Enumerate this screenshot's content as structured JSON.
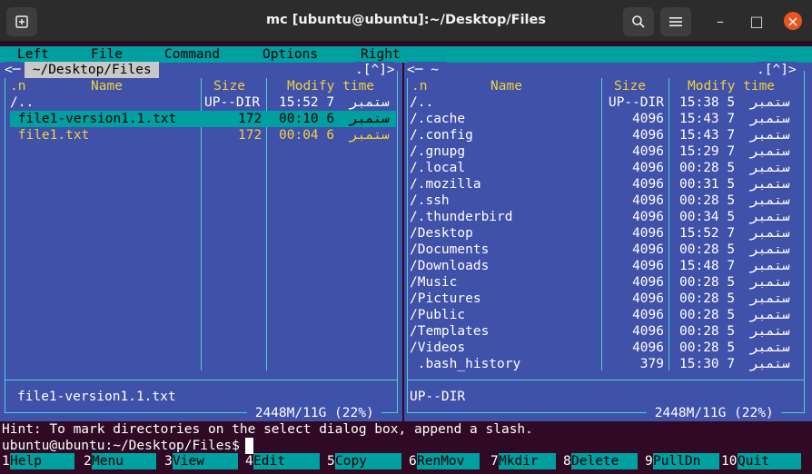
{
  "window": {
    "title": "mc [ubuntu@ubuntu]:~/Desktop/Files",
    "new_tab_icon": "new-tab-icon",
    "search_icon": "search-icon",
    "menu_icon": "hamburger-icon",
    "minimize": "–",
    "maximize": "□",
    "close": "×"
  },
  "menu": [
    "Left",
    "File",
    "Command",
    "Options",
    "Right"
  ],
  "left_panel": {
    "corner_left": "<─",
    "path": " ~/Desktop/Files ",
    "corner_right": ".[^]>",
    "headers": {
      "n": ".n",
      "name": "Name",
      "size": "Size",
      "modify": "Modify time"
    },
    "rows": [
      {
        "name": "/..",
        "size": "UP--DIR",
        "time": "15:52 7",
        "date": "ستمبر",
        "style": "wht"
      },
      {
        "name": " file1-version1.1.txt",
        "size": "172",
        "time": "00:10 6",
        "date": "ستمبر",
        "style": "sel"
      },
      {
        "name": " file1.txt",
        "size": "172",
        "time": "00:04 6",
        "date": "ستمبر",
        "style": "yel"
      }
    ],
    "status": "file1-version1.1.txt",
    "disk": " 2448M/11G (22%) "
  },
  "right_panel": {
    "corner_left": "<─ ~ ",
    "corner_right": ".[^]>",
    "headers": {
      "n": ".n",
      "name": "Name",
      "size": "Size",
      "modify": "Modify time"
    },
    "rows": [
      {
        "name": "/..",
        "size": "UP--DIR",
        "time": "15:38 5",
        "date": "ستمبر"
      },
      {
        "name": "/.cache",
        "size": "4096",
        "time": "15:43 7",
        "date": "ستمبر"
      },
      {
        "name": "/.config",
        "size": "4096",
        "time": "15:43 7",
        "date": "ستمبر"
      },
      {
        "name": "/.gnupg",
        "size": "4096",
        "time": "15:29 7",
        "date": "ستمبر"
      },
      {
        "name": "/.local",
        "size": "4096",
        "time": "00:28 5",
        "date": "ستمبر"
      },
      {
        "name": "/.mozilla",
        "size": "4096",
        "time": "00:31 5",
        "date": "ستمبر"
      },
      {
        "name": "/.ssh",
        "size": "4096",
        "time": "00:28 5",
        "date": "ستمبر"
      },
      {
        "name": "/.thunderbird",
        "size": "4096",
        "time": "00:34 5",
        "date": "ستمبر"
      },
      {
        "name": "/Desktop",
        "size": "4096",
        "time": "15:52 7",
        "date": "ستمبر"
      },
      {
        "name": "/Documents",
        "size": "4096",
        "time": "00:28 5",
        "date": "ستمبر"
      },
      {
        "name": "/Downloads",
        "size": "4096",
        "time": "15:48 7",
        "date": "ستمبر"
      },
      {
        "name": "/Music",
        "size": "4096",
        "time": "00:28 5",
        "date": "ستمبر"
      },
      {
        "name": "/Pictures",
        "size": "4096",
        "time": "00:28 5",
        "date": "ستمبر"
      },
      {
        "name": "/Public",
        "size": "4096",
        "time": "00:28 5",
        "date": "ستمبر"
      },
      {
        "name": "/Templates",
        "size": "4096",
        "time": "00:28 5",
        "date": "ستمبر"
      },
      {
        "name": "/Videos",
        "size": "4096",
        "time": "00:28 5",
        "date": "ستمبر"
      },
      {
        "name": " .bash_history",
        "size": "379",
        "time": "15:30 7",
        "date": "ستمبر"
      }
    ],
    "status": "UP--DIR",
    "disk": " 2448M/11G (22%) "
  },
  "hint": "Hint: To mark directories on the select dialog box, append a slash.",
  "prompt": "ubuntu@ubuntu:~/Desktop/Files$ ",
  "fkeys": [
    {
      "num": "1",
      "label": "Help"
    },
    {
      "num": "2",
      "label": "Menu"
    },
    {
      "num": "3",
      "label": "View"
    },
    {
      "num": "4",
      "label": "Edit"
    },
    {
      "num": "5",
      "label": "Copy"
    },
    {
      "num": "6",
      "label": "RenMov"
    },
    {
      "num": "7",
      "label": "Mkdir"
    },
    {
      "num": "8",
      "label": "Delete"
    },
    {
      "num": "9",
      "label": "PullDn"
    },
    {
      "num": "10",
      "label": "Quit"
    }
  ],
  "colors": {
    "panel": "#3f51a8",
    "cyan": "#00a0a0",
    "selected": "#00a0a0",
    "file_yellow": "#f1d040",
    "terminal_bg": "#300a24"
  }
}
